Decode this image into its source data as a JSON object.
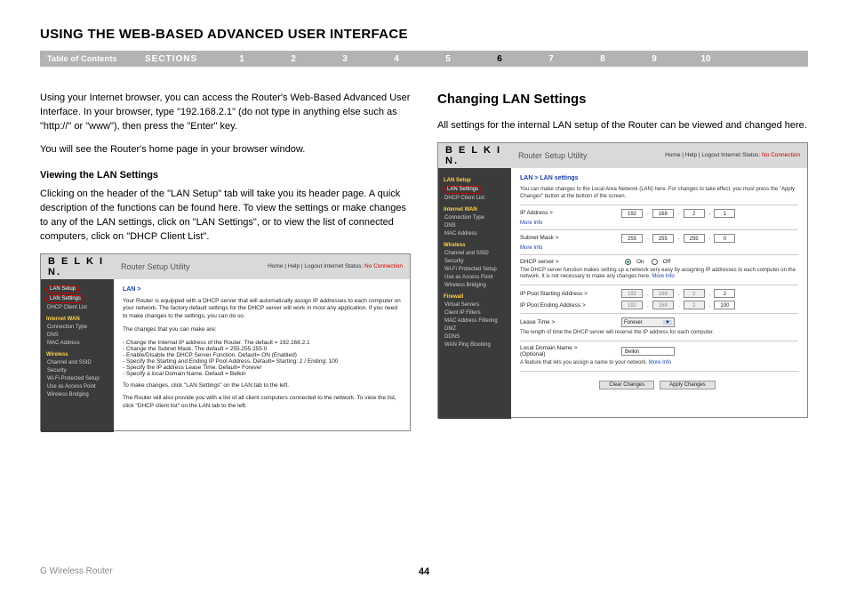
{
  "header": {
    "title": "USING THE WEB-BASED ADVANCED USER INTERFACE",
    "toc_label": "Table of Contents",
    "sections_label": "SECTIONS",
    "nums": [
      "1",
      "2",
      "3",
      "4",
      "5",
      "6",
      "7",
      "8",
      "9",
      "10"
    ],
    "current_num": "6"
  },
  "left": {
    "intro_p1": "Using your Internet browser, you can access the Router's Web-Based Advanced User Interface. In your browser, type \"192.168.2.1\" (do not type in anything else such as \"http://\" or \"www\"), then press the \"Enter\" key.",
    "intro_p2": "You will see the Router's home page in your browser window.",
    "view_head": "Viewing the LAN Settings",
    "view_p": "Clicking on the header of the \"LAN Setup\" tab will take you its header page. A quick description of the functions can be found here. To view the settings or make changes to any of the LAN settings, click on \"LAN Settings\", or to view the list of connected computers, click on \"DHCP Client List\".",
    "router": {
      "logo": "B E L K I N.",
      "utility": "Router Setup Utility",
      "top_links": "Home | Help | Logout   Internet Status:",
      "no_conn": "No Connection",
      "side": {
        "lan_setup": "LAN Setup",
        "lan_settings": "LAN Settings",
        "dhcp_list": "DHCP Client List",
        "wan": "Internet WAN",
        "wan_items": [
          "Connection Type",
          "DNS",
          "MAC Address"
        ],
        "wireless": "Wireless",
        "wl_items": [
          "Channel and SSID",
          "Security",
          "Wi-Fi Protected Setup",
          "Use as Access Point",
          "Wireless Bridging"
        ]
      },
      "content": {
        "crumb": "LAN >",
        "desc": "Your Router is equipped with a DHCP server that will automatically assign IP addresses to each computer on your network. The factory default settings for the DHCP server will work in most any application. If you need to make changes to the settings, you can do so.",
        "changes_intro": "The changes that you can make are:",
        "bullets": [
          "Change the Internal IP address of the Router. The default = 192.168.2.1",
          "Change the Subnet Mask. The default = 255.255.255.0",
          "Enable/Disable the DHCP Server Function. Default= ON (Enabled)",
          "Specify the Starting and Ending IP Pool Address. Default= Starting: 2 / Ending: 100",
          "Specify the IP address Lease Time. Default= Forever",
          "Specify a local Domain Name. Default = Belkin"
        ],
        "tail1": "To make changes, click \"LAN Settings\" on the LAN tab to the left.",
        "tail2": "The Router will also provide you with a list of all client computers connected to the network. To view the list, click \"DHCP client list\" on the LAN tab to the left."
      }
    }
  },
  "right": {
    "head": "Changing LAN Settings",
    "intro": "All settings for the internal LAN setup of the Router can be viewed and changed here.",
    "router": {
      "logo": "B E L K I N.",
      "utility": "Router Setup Utility",
      "top_links": "Home | Help | Logout   Internet Status:",
      "no_conn": "No Connection",
      "side": {
        "lan_setup": "LAN Setup",
        "lan_settings": "LAN Settings",
        "dhcp_list": "DHCP Client List",
        "wan": "Internet WAN",
        "wan_items": [
          "Connection Type",
          "DNS",
          "MAC Address"
        ],
        "wireless": "Wireless",
        "wl_items": [
          "Channel and SSID",
          "Security",
          "Wi-Fi Protected Setup",
          "Use as Access Point",
          "Wireless Bridging"
        ],
        "firewall": "Firewall",
        "fw_items": [
          "Virtual Servers",
          "Client IP Filters",
          "MAC Address Filtering",
          "DMZ",
          "DDNS",
          "WAN Ping Blocking"
        ]
      },
      "content": {
        "crumb": "LAN > LAN settings",
        "desc": "You can make changes to the Local Area Network (LAN) here. For changes to take effect, you must press the \"Apply Changes\" button at the bottom of the screen.",
        "ip_label": "IP Address >",
        "ip": [
          "192",
          "168",
          "2",
          "1"
        ],
        "more_info": "More Info",
        "mask_label": "Subnet Mask >",
        "mask": [
          "255",
          "255",
          "255",
          "0"
        ],
        "dhcp_label": "DHCP server >",
        "dhcp_on": "On",
        "dhcp_off": "Off",
        "dhcp_desc": "The DHCP server function makes setting up a network very easy by assigning IP addresses to each computer on the network. It is not necessary to make any changes here.",
        "pool_start_label": "IP Pool Starting Address >",
        "pool_start": [
          "192",
          "168",
          "2",
          "2"
        ],
        "pool_end_label": "IP Pool Ending Address >",
        "pool_end": [
          "192",
          "168",
          "2",
          "100"
        ],
        "lease_label": "Lease Time >",
        "lease_val": "Forever",
        "lease_desc": "The length of time the DHCP server will reserve the IP address for each computer.",
        "domain_label": "Local Domain Name >",
        "domain_opt": "(Optional)",
        "domain_val": "Belkin",
        "domain_desc": "A feature that lets you assign a name to your network.",
        "btn_clear": "Clear Changes",
        "btn_apply": "Apply Changes"
      }
    }
  },
  "footer": {
    "product": "G Wireless Router",
    "page": "44"
  }
}
